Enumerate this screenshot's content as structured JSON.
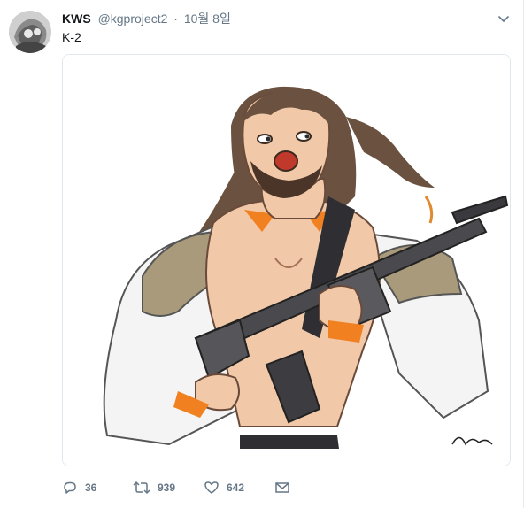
{
  "tweet": {
    "display_name": "KWS",
    "handle": "@kgproject2",
    "separator": "·",
    "date": "10월 8일",
    "text": "K-2",
    "reply_count": "36",
    "retweet_count": "939",
    "like_count": "642"
  },
  "colors": {
    "text": "#14171a",
    "muted": "#657786",
    "border": "#e1e8ed",
    "accent_orange": "#f08020"
  },
  "icons": [
    "chevron-down-icon",
    "reply-icon",
    "retweet-icon",
    "heart-icon",
    "envelope-icon"
  ]
}
